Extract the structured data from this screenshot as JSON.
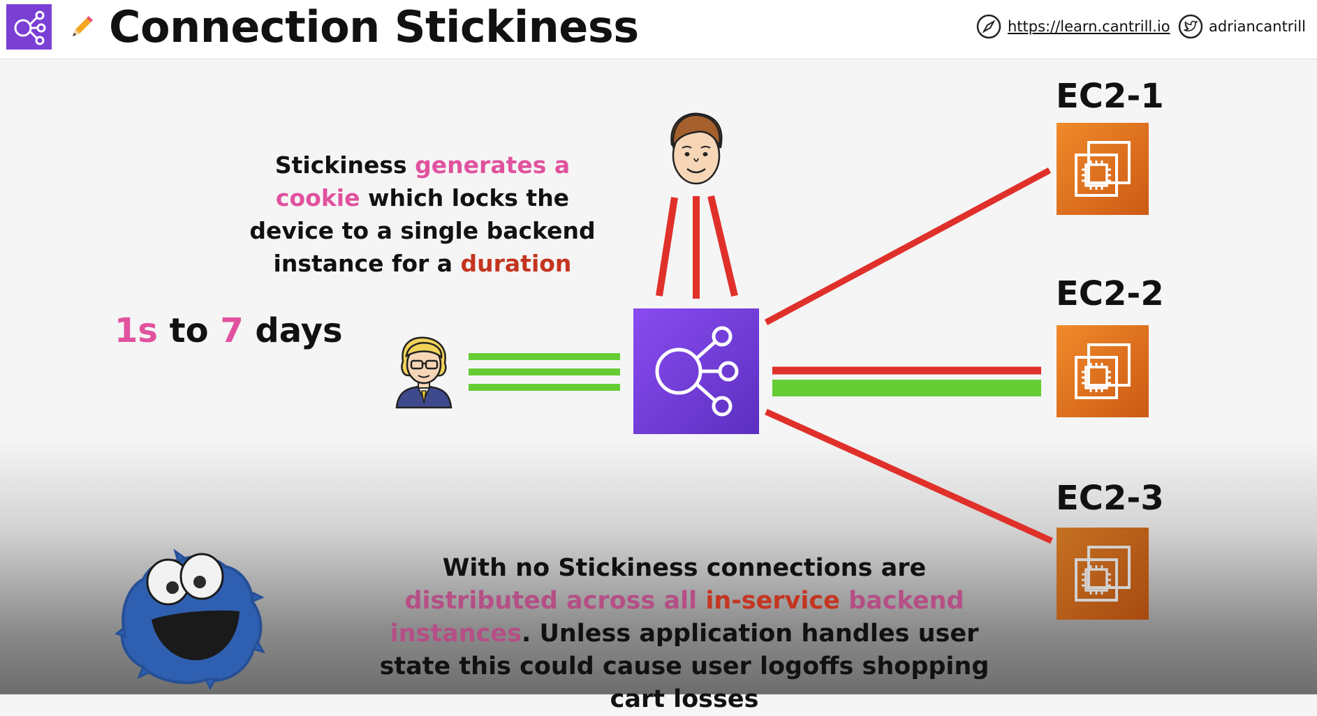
{
  "header": {
    "title": "Connection Stickiness",
    "url": "https://learn.cantrill.io",
    "twitter": "adriancantrill"
  },
  "description": {
    "p1": "Stickiness ",
    "h1": "generates a cookie",
    "p2": " which locks the device to a single backend instance for a ",
    "h2": "duration"
  },
  "duration_range": {
    "min": "1s",
    "to": " to ",
    "max": "7",
    "unit": " days"
  },
  "instances": [
    {
      "label": "EC2-1"
    },
    {
      "label": "EC2-2"
    },
    {
      "label": "EC2-3"
    }
  ],
  "bottom_note": {
    "p1": "With no Stickiness connections are ",
    "h1": "distributed across all ",
    "h2": "in-service",
    "h3": " backend instances",
    "p2": ". Unless application handles user state this could cause user logoffs shopping cart losses"
  },
  "colors": {
    "accent_pink": "#e0529e",
    "accent_red": "#c43520",
    "elb_purple": "#7b3fd4",
    "ec2_orange": "#e87722",
    "line_red": "#e0302a",
    "line_green": "#66cc33"
  },
  "icons": [
    "load-balancer-icon",
    "pencil-icon",
    "compass-icon",
    "twitter-icon",
    "ec2-chip-icon",
    "cookie-monster-icon",
    "user-male-icon",
    "user-female-icon"
  ]
}
